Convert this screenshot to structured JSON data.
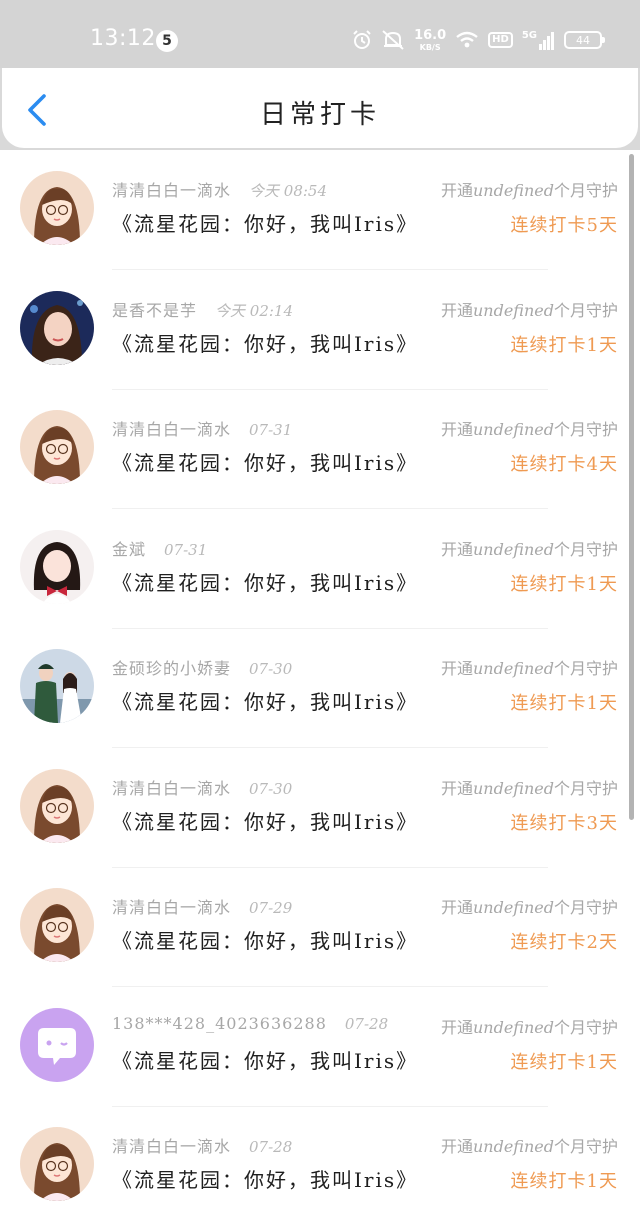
{
  "status_bar": {
    "time": "13:12",
    "notification_count": "5",
    "net_speed_value": "16.0",
    "net_speed_unit": "KB/S",
    "hd_label": "HD",
    "network_label": "5G",
    "battery": "44",
    "icons": [
      "alarm-icon",
      "mute-icon",
      "wifi-icon",
      "signal-icon"
    ]
  },
  "header": {
    "title": "日常打卡",
    "back_icon": "back-chevron-icon",
    "accent_color": "#2b8cf0"
  },
  "colors": {
    "streak": "#ef9a52",
    "meta": "#a7a7a7",
    "song": "#1f1f1f"
  },
  "guard_prefix": "开通",
  "guard_mid": "undefined",
  "guard_suffix": "个月守护",
  "entries": [
    {
      "user": "清清白白一滴水",
      "date": "今天 08:54",
      "song": "《流星花园：你好，我叫Iris》",
      "streak": "连续打卡5天",
      "avatar": "avatar-girl-glasses"
    },
    {
      "user": "是香不是芋",
      "date": "今天 02:14",
      "song": "《流星花园：你好，我叫Iris》",
      "streak": "连续打卡1天",
      "avatar": "avatar-woman-photo"
    },
    {
      "user": "清清白白一滴水",
      "date": "07-31",
      "song": "《流星花园：你好，我叫Iris》",
      "streak": "连续打卡4天",
      "avatar": "avatar-girl-glasses"
    },
    {
      "user": "金斌",
      "date": "07-31",
      "song": "《流星花园：你好，我叫Iris》",
      "streak": "连续打卡1天",
      "avatar": "avatar-girl-bow"
    },
    {
      "user": "金硕珍的小娇妻",
      "date": "07-30",
      "song": "《流星花园：你好，我叫Iris》",
      "streak": "连续打卡1天",
      "avatar": "avatar-couple-photo"
    },
    {
      "user": "清清白白一滴水",
      "date": "07-30",
      "song": "《流星花园：你好，我叫Iris》",
      "streak": "连续打卡3天",
      "avatar": "avatar-girl-glasses"
    },
    {
      "user": "清清白白一滴水",
      "date": "07-29",
      "song": "《流星花园：你好，我叫Iris》",
      "streak": "连续打卡2天",
      "avatar": "avatar-girl-glasses"
    },
    {
      "user": "138***428_4023636288",
      "date": "07-28",
      "song": "《流星花园：你好，我叫Iris》",
      "streak": "连续打卡1天",
      "avatar": "avatar-default-chat"
    },
    {
      "user": "清清白白一滴水",
      "date": "07-28",
      "song": "《流星花园：你好，我叫Iris》",
      "streak": "连续打卡1天",
      "avatar": "avatar-girl-glasses"
    }
  ]
}
